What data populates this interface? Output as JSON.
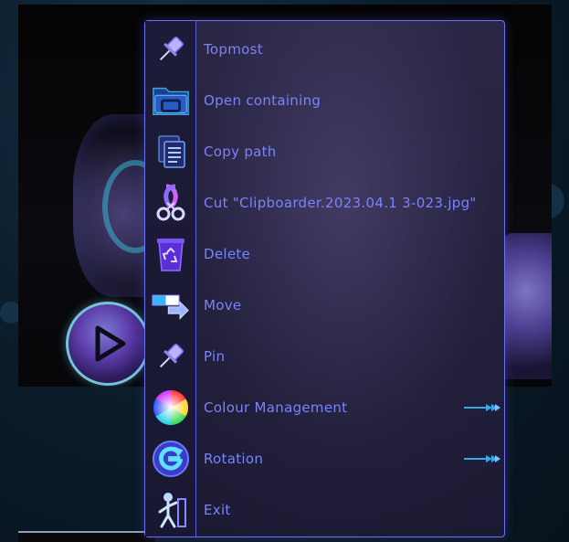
{
  "menu": {
    "items": [
      {
        "label": "Topmost",
        "icon": "pin-icon"
      },
      {
        "label": "Open containing",
        "icon": "folder-icon"
      },
      {
        "label": "Copy path",
        "icon": "copy-document-icon"
      },
      {
        "label": "Cut \"Clipboarder.2023.04.1 3-023.jpg\"",
        "icon": "scissors-icon"
      },
      {
        "label": "Delete",
        "icon": "recycle-bin-icon"
      },
      {
        "label": "Move",
        "icon": "move-arrow-icon"
      },
      {
        "label": "Pin",
        "icon": "pin-icon"
      },
      {
        "label": "Colour Management",
        "icon": "color-wheel-icon",
        "has_submenu": true
      },
      {
        "label": "Rotation",
        "icon": "rotate-icon",
        "has_submenu": true
      },
      {
        "label": "Exit",
        "icon": "exit-figure-icon"
      }
    ]
  },
  "colors": {
    "menu_text": "#7a82ff",
    "menu_border": "#6d72f0",
    "submenu_arrow": "#3aa7e6"
  }
}
